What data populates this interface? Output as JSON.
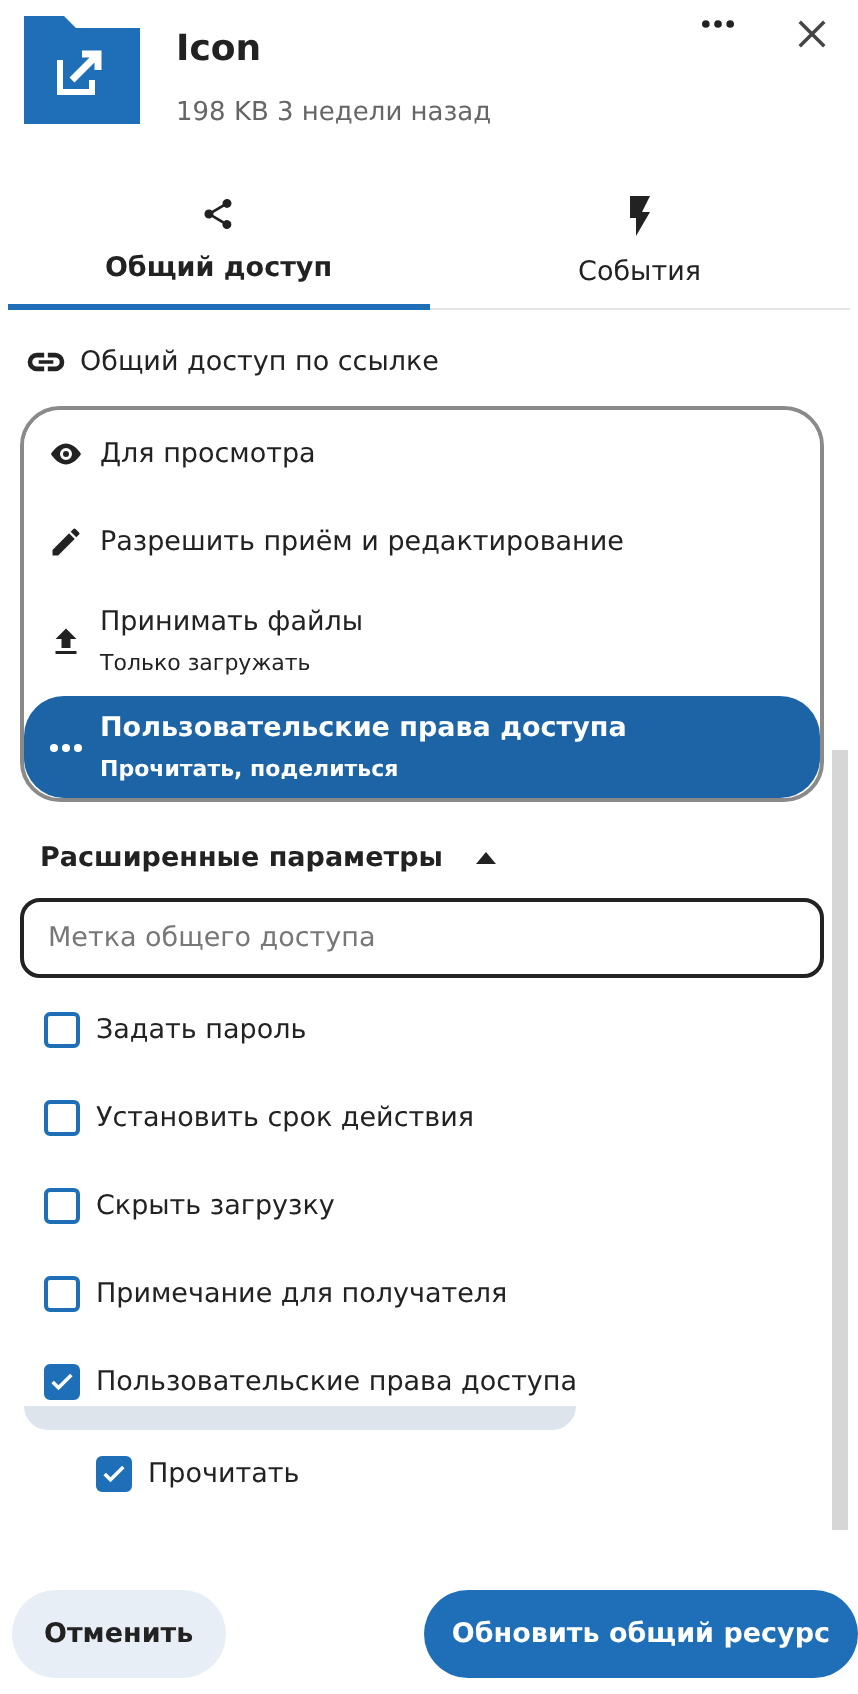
{
  "header": {
    "title": "Icon",
    "meta": "198 KB 3 недели назад"
  },
  "tabs": [
    {
      "label": "Общий доступ",
      "selected": true
    },
    {
      "label": "События",
      "selected": false
    }
  ],
  "link_share": "Общий доступ по ссылке",
  "permissions": [
    {
      "label": "Для просмотра",
      "selected": false
    },
    {
      "label": "Разрешить приём и редактирование",
      "selected": false
    },
    {
      "label": "Принимать файлы",
      "subtitle": "Только загружать",
      "selected": false
    },
    {
      "label": "Пользовательские права доступа",
      "subtitle": "Прочитать, поделиться",
      "selected": true
    }
  ],
  "advanced": {
    "title": "Расширенные параметры",
    "expanded": true
  },
  "label_field": {
    "placeholder": "Метка общего доступа"
  },
  "options": [
    {
      "label": "Задать пароль",
      "checked": false
    },
    {
      "label": "Установить срок действия",
      "checked": false
    },
    {
      "label": "Скрыть загрузку",
      "checked": false
    },
    {
      "label": "Примечание для получателя",
      "checked": false
    },
    {
      "label": "Пользовательские права доступа",
      "checked": true,
      "children": [
        {
          "label": "Прочитать",
          "checked": true
        }
      ]
    }
  ],
  "buttons": {
    "cancel": "Отменить",
    "submit": "Обновить общий ресурс"
  }
}
